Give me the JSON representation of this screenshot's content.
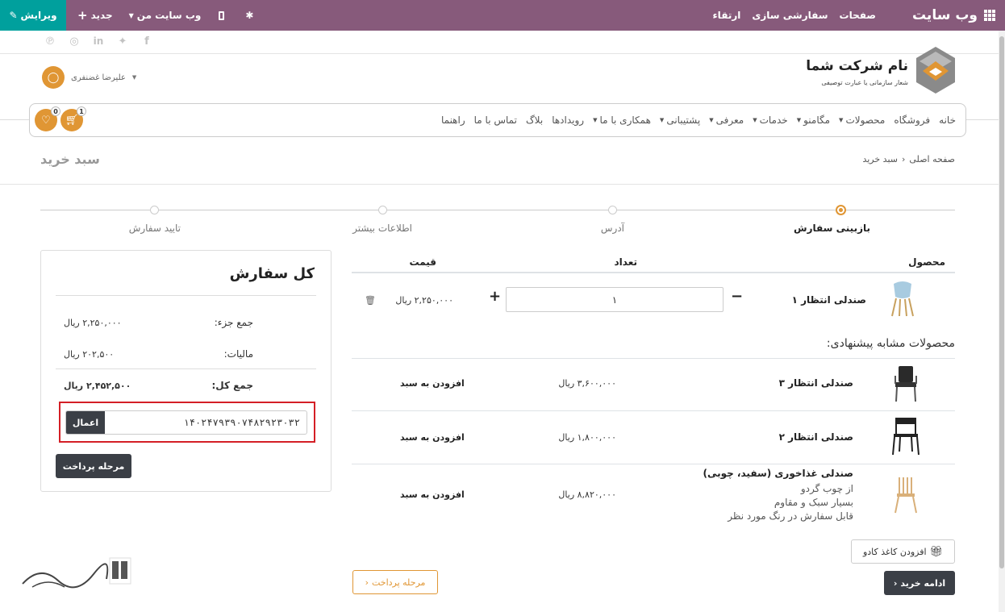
{
  "topbar": {
    "brand": "وب سایت",
    "nav": [
      "صفحات",
      "سفارشی سازی",
      "ارتقاء"
    ],
    "edit_label": "ویرایش",
    "new_label": "جدید",
    "my_site_label": "وب سایت من",
    "color": "#875a7b",
    "edit_color": "#00a09d"
  },
  "logo": {
    "title": "نام شرکت شما",
    "subtitle": "شعار سازمانی یا عبارت توصیفی"
  },
  "user": {
    "name": "علیرضا غضنفری"
  },
  "mainnav": {
    "items": [
      {
        "label": "خانه",
        "caret": false
      },
      {
        "label": "فروشگاه",
        "caret": false
      },
      {
        "label": "محصولات",
        "caret": true
      },
      {
        "label": "مگامنو",
        "caret": true
      },
      {
        "label": "خدمات",
        "caret": true
      },
      {
        "label": "معرفی",
        "caret": true
      },
      {
        "label": "پشتیبانی",
        "caret": true
      },
      {
        "label": "همکاری با ما",
        "caret": true
      },
      {
        "label": "رویدادها",
        "caret": false
      },
      {
        "label": "بلاگ",
        "caret": false
      },
      {
        "label": "تماس با ما",
        "caret": false
      },
      {
        "label": "راهنما",
        "caret": false
      }
    ],
    "cart_count": "1",
    "wishlist_count": "0"
  },
  "page": {
    "title": "سبد خرید",
    "breadcrumb_home": "صفحه اصلی",
    "breadcrumb_current": "سبد خرید"
  },
  "steps": [
    {
      "label": "بازبینی سفارش",
      "active": true
    },
    {
      "label": "آدرس",
      "active": false
    },
    {
      "label": "اطلاعات بیشتر",
      "active": false
    },
    {
      "label": "تایید سفارش",
      "active": false
    }
  ],
  "summary": {
    "title": "کل سفارش",
    "subtotal_label": "جمع جزء:",
    "subtotal_value": "۲,۲۵۰,۰۰۰ ریال",
    "tax_label": "مالیات:",
    "tax_value": "۲۰۲,۵۰۰ ریال",
    "total_label": "جمع کل:",
    "total_value": "۲,۴۵۲,۵۰۰ ریال",
    "coupon_value": "۱۴۰۲۴۷۹۳۹۰۷۴۸۲۹۲۳۰۳۲",
    "apply_label": "اعمال",
    "checkout_label": "مرحله پرداخت"
  },
  "cart": {
    "headers": {
      "product": "محصول",
      "quantity": "تعداد",
      "price": "قیمت"
    },
    "items": [
      {
        "name": "صندلی انتظار ۱",
        "quantity": "۱",
        "price": "۲,۲۵۰,۰۰۰ ریال"
      }
    ]
  },
  "suggested": {
    "title": "محصولات مشابه پیشنهادی:",
    "add_label": "افزودن به سبد",
    "items": [
      {
        "name": "صندلی انتظار ۳",
        "price": "۳,۶۰۰,۰۰۰ ریال"
      },
      {
        "name": "صندلی انتظار ۲",
        "price": "۱,۸۰۰,۰۰۰ ریال"
      },
      {
        "name": "صندلی غذاخوری (سفید، چوبی)",
        "price": "۸,۸۲۰,۰۰۰ ریال",
        "desc": [
          "از چوب گردو",
          "بسیار سبک و مقاوم",
          "قابل سفارش در رنگ مورد نظر"
        ]
      }
    ]
  },
  "actions": {
    "gift_label": "افزودن کاغذ کادو",
    "continue_label": "ادامه خرید",
    "checkout_label": "مرحله پرداخت"
  },
  "colors": {
    "accent": "#e09634",
    "dark_button": "#3b3f46",
    "highlight": "#d41f26"
  }
}
